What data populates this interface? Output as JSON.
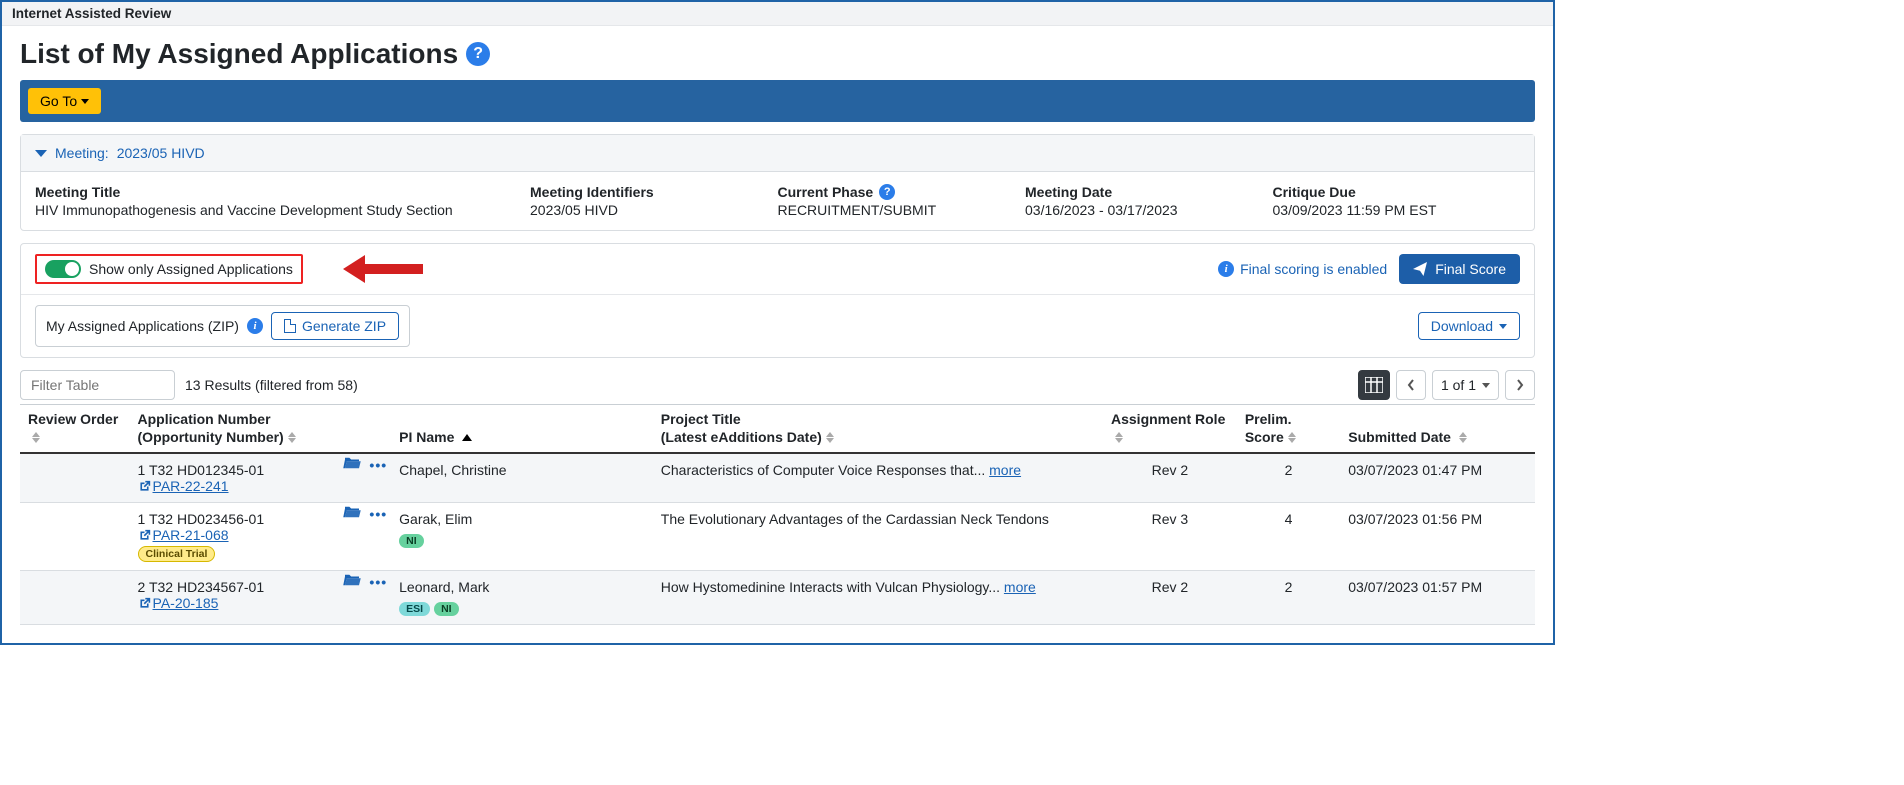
{
  "topbar": {
    "title": "Internet Assisted Review"
  },
  "page": {
    "title": "List of My Assigned Applications"
  },
  "toolbar": {
    "goto_label": "Go To"
  },
  "meeting_panel": {
    "header_label": "Meeting:",
    "header_value": "2023/05 HIVD",
    "cols": {
      "title_label": "Meeting Title",
      "title_value": "HIV Immunopathogenesis and Vaccine Development Study Section",
      "idents_label": "Meeting Identifiers",
      "idents_value": "2023/05 HIVD",
      "phase_label": "Current Phase",
      "phase_value": "RECRUITMENT/SUBMIT",
      "date_label": "Meeting Date",
      "date_value": "03/16/2023 - 03/17/2023",
      "critique_label": "Critique Due",
      "critique_value": "03/09/2023 11:59 PM EST"
    }
  },
  "filterbar": {
    "toggle_label": "Show only Assigned Applications",
    "scoring_text": "Final scoring is enabled",
    "final_score_btn": "Final Score",
    "zip_label": "My Assigned Applications (ZIP)",
    "generate_zip_btn": "Generate ZIP",
    "download_btn": "Download"
  },
  "table_controls": {
    "filter_placeholder": "Filter Table",
    "results_text": "13 Results (filtered from 58)",
    "pager_label": "1 of 1"
  },
  "columns": {
    "review_order": "Review Order",
    "app_num_l1": "Application Number",
    "app_num_l2": "(Opportunity Number)",
    "pi_name": "PI Name",
    "project_l1": "Project Title",
    "project_l2": "(Latest eAdditions Date)",
    "assignment": "Assignment Role",
    "prelim_l1": "Prelim.",
    "prelim_l2": "Score",
    "submitted": "Submitted Date"
  },
  "rows": [
    {
      "app_num": "1 T32 HD012345-01",
      "opp_num": "PAR-22-241",
      "pi": "Chapel, Christine",
      "badges": [],
      "title_text": "Characteristics of Computer Voice Responses that...",
      "title_more": "more",
      "role": "Rev 2",
      "score": "2",
      "submitted": "03/07/2023 01:47 PM"
    },
    {
      "app_num": "1 T32 HD023456-01",
      "opp_num": "PAR-21-068",
      "pi": "Garak, Elim",
      "badges": [
        "CT",
        "NI"
      ],
      "title_text": "The Evolutionary Advantages of the Cardassian Neck Tendons",
      "title_more": "",
      "role": "Rev 3",
      "score": "4",
      "submitted": "03/07/2023 01:56 PM"
    },
    {
      "app_num": "2 T32 HD234567-01",
      "opp_num": "PA-20-185",
      "pi": "Leonard, Mark",
      "badges": [
        "ESI",
        "NI"
      ],
      "title_text": "How Hystomedinine Interacts with Vulcan Physiology...",
      "title_more": "more",
      "role": "Rev 2",
      "score": "2",
      "submitted": "03/07/2023 01:57 PM"
    }
  ],
  "badge_labels": {
    "CT": "Clinical Trial",
    "NI": "NI",
    "ESI": "ESI"
  }
}
